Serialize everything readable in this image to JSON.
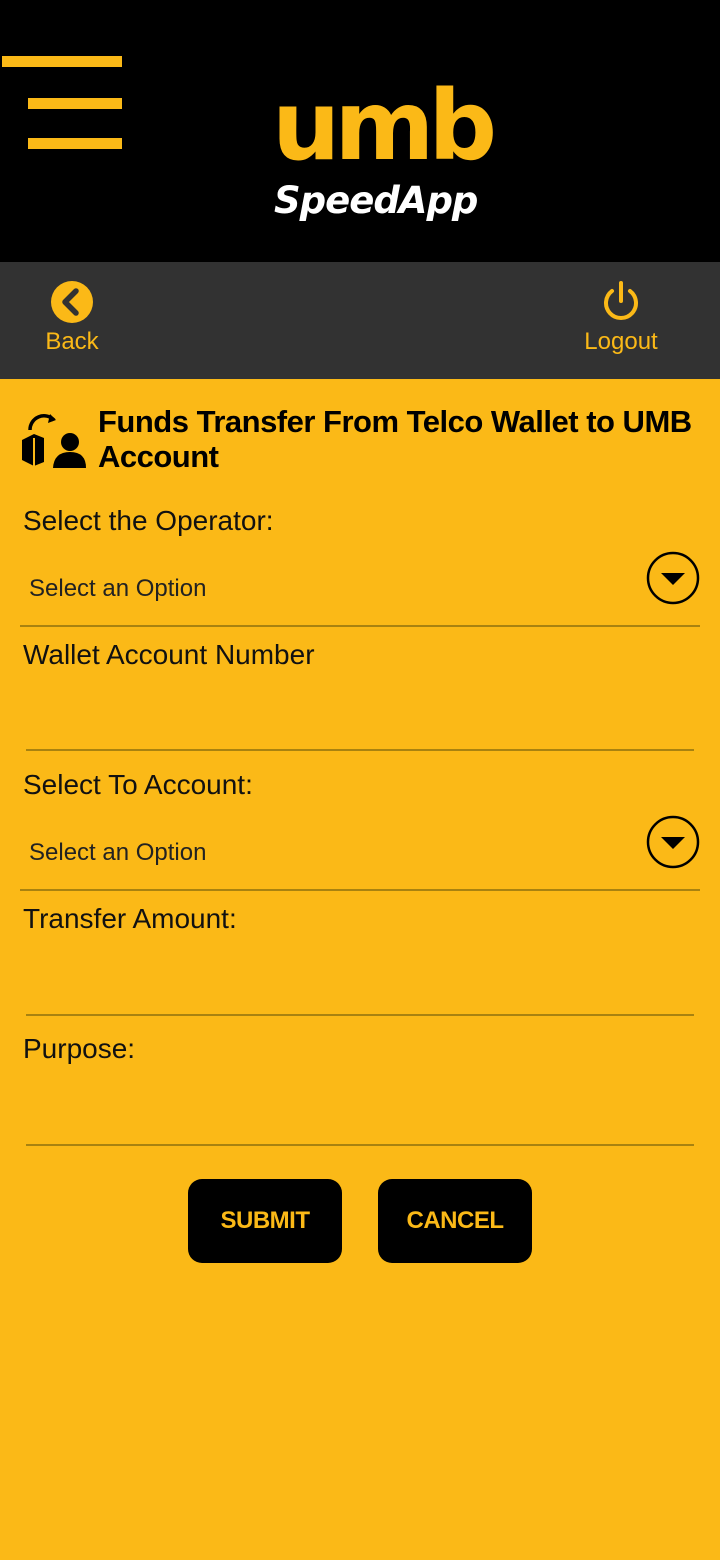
{
  "header": {
    "logo_umb": "umb",
    "logo_speedapp": "SpeedApp"
  },
  "navbar": {
    "back_label": "Back",
    "logout_label": "Logout"
  },
  "page": {
    "title": "Funds Transfer From Telco Wallet to UMB Account"
  },
  "form": {
    "operator_label": "Select the Operator:",
    "operator_value": "Select an Option",
    "wallet_label": "Wallet Account Number",
    "to_account_label": "Select To Account:",
    "to_account_value": "Select an Option",
    "amount_label": "Transfer Amount:",
    "purpose_label": "Purpose:"
  },
  "actions": {
    "submit_label": "SUBMIT",
    "cancel_label": "CANCEL"
  },
  "colors": {
    "accent": "#fbb917",
    "header_bg": "#000000",
    "navbar_bg": "#323232"
  }
}
